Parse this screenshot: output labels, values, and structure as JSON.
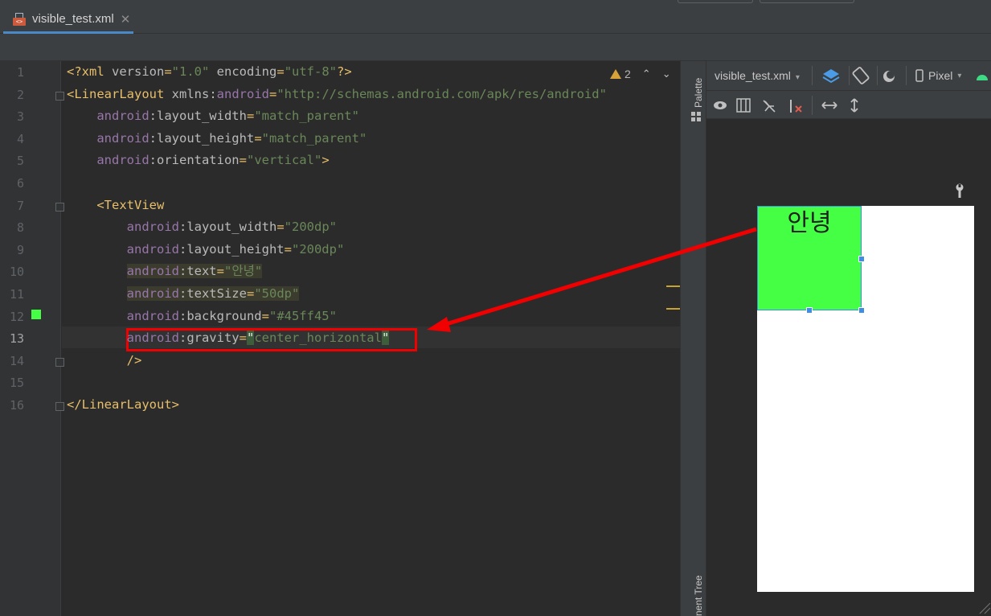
{
  "tab": {
    "title": "visible_test.xml",
    "close": "✕",
    "icon_letters": "<>"
  },
  "editor": {
    "line_numbers": [
      "1",
      "2",
      "3",
      "4",
      "5",
      "6",
      "7",
      "8",
      "9",
      "10",
      "11",
      "12",
      "13",
      "14",
      "15",
      "16"
    ],
    "current_line": "13",
    "lines": [
      [
        {
          "c": "tag",
          "t": "<?xml "
        },
        {
          "c": "attr",
          "t": "version"
        },
        {
          "c": "tag",
          "t": "="
        },
        {
          "c": "str",
          "t": "\"1.0\""
        },
        {
          "c": "attr",
          "t": " encoding"
        },
        {
          "c": "tag",
          "t": "="
        },
        {
          "c": "str",
          "t": "\"utf-8\""
        },
        {
          "c": "tag",
          "t": "?>"
        }
      ],
      [
        {
          "c": "tag",
          "t": "<LinearLayout "
        },
        {
          "c": "attr",
          "t": "xmlns:"
        },
        {
          "c": "ns",
          "t": "android"
        },
        {
          "c": "tag",
          "t": "="
        },
        {
          "c": "str",
          "t": "\"http://schemas.android.com/apk/res/android\""
        }
      ],
      [
        {
          "c": "attr",
          "t": "    "
        },
        {
          "c": "ns",
          "t": "android"
        },
        {
          "c": "attr",
          "t": ":layout_width"
        },
        {
          "c": "tag",
          "t": "="
        },
        {
          "c": "str",
          "t": "\"match_parent\""
        }
      ],
      [
        {
          "c": "attr",
          "t": "    "
        },
        {
          "c": "ns",
          "t": "android"
        },
        {
          "c": "attr",
          "t": ":layout_height"
        },
        {
          "c": "tag",
          "t": "="
        },
        {
          "c": "str",
          "t": "\"match_parent\""
        }
      ],
      [
        {
          "c": "attr",
          "t": "    "
        },
        {
          "c": "ns",
          "t": "android"
        },
        {
          "c": "attr",
          "t": ":orientation"
        },
        {
          "c": "tag",
          "t": "="
        },
        {
          "c": "str",
          "t": "\"vertical\""
        },
        {
          "c": "tag",
          "t": ">"
        }
      ],
      [],
      [
        {
          "c": "attr",
          "t": "    "
        },
        {
          "c": "tag",
          "t": "<TextView"
        }
      ],
      [
        {
          "c": "attr",
          "t": "        "
        },
        {
          "c": "ns",
          "t": "android"
        },
        {
          "c": "attr",
          "t": ":layout_width"
        },
        {
          "c": "tag",
          "t": "="
        },
        {
          "c": "str",
          "t": "\"200dp\""
        }
      ],
      [
        {
          "c": "attr",
          "t": "        "
        },
        {
          "c": "ns",
          "t": "android"
        },
        {
          "c": "attr",
          "t": ":layout_height"
        },
        {
          "c": "tag",
          "t": "="
        },
        {
          "c": "str",
          "t": "\"200dp\""
        }
      ],
      [
        {
          "c": "attr",
          "t": "        "
        },
        {
          "c": "ns hl",
          "t": "android"
        },
        {
          "c": "attr hl",
          "t": ":text"
        },
        {
          "c": "tag hl",
          "t": "="
        },
        {
          "c": "str hl",
          "t": "\"안녕\""
        }
      ],
      [
        {
          "c": "attr",
          "t": "        "
        },
        {
          "c": "ns hl",
          "t": "android"
        },
        {
          "c": "attr hl",
          "t": ":textSize"
        },
        {
          "c": "tag hl",
          "t": "="
        },
        {
          "c": "str hl",
          "t": "\"50dp\""
        }
      ],
      [
        {
          "c": "attr",
          "t": "        "
        },
        {
          "c": "ns",
          "t": "android"
        },
        {
          "c": "attr",
          "t": ":background"
        },
        {
          "c": "tag",
          "t": "="
        },
        {
          "c": "str",
          "t": "\"#45ff45\""
        }
      ],
      [
        {
          "c": "attr",
          "t": "        "
        },
        {
          "c": "ns",
          "t": "android"
        },
        {
          "c": "attr",
          "t": ":gravity"
        },
        {
          "c": "tag",
          "t": "="
        },
        {
          "c": "qhl",
          "t": "\""
        },
        {
          "c": "str",
          "t": "center_horizontal"
        },
        {
          "c": "qhl",
          "t": "\""
        }
      ],
      [
        {
          "c": "attr",
          "t": "        "
        },
        {
          "c": "tag",
          "t": "/>"
        }
      ],
      [],
      [
        {
          "c": "tag",
          "t": "</LinearLayout>"
        }
      ]
    ],
    "warnings": {
      "count": "2",
      "up": "⌃",
      "down": "⌄"
    }
  },
  "side_panels": {
    "palette": "Palette",
    "component_tree": "nent Tree"
  },
  "design": {
    "file_select": "visible_test.xml",
    "device_select": "Pixel",
    "preview_text": "안녕",
    "preview_bg": "#45ff45"
  },
  "colors": {
    "highlight_box": "#f00000",
    "arrow": "#f00000",
    "accent": "#4a88c7"
  }
}
